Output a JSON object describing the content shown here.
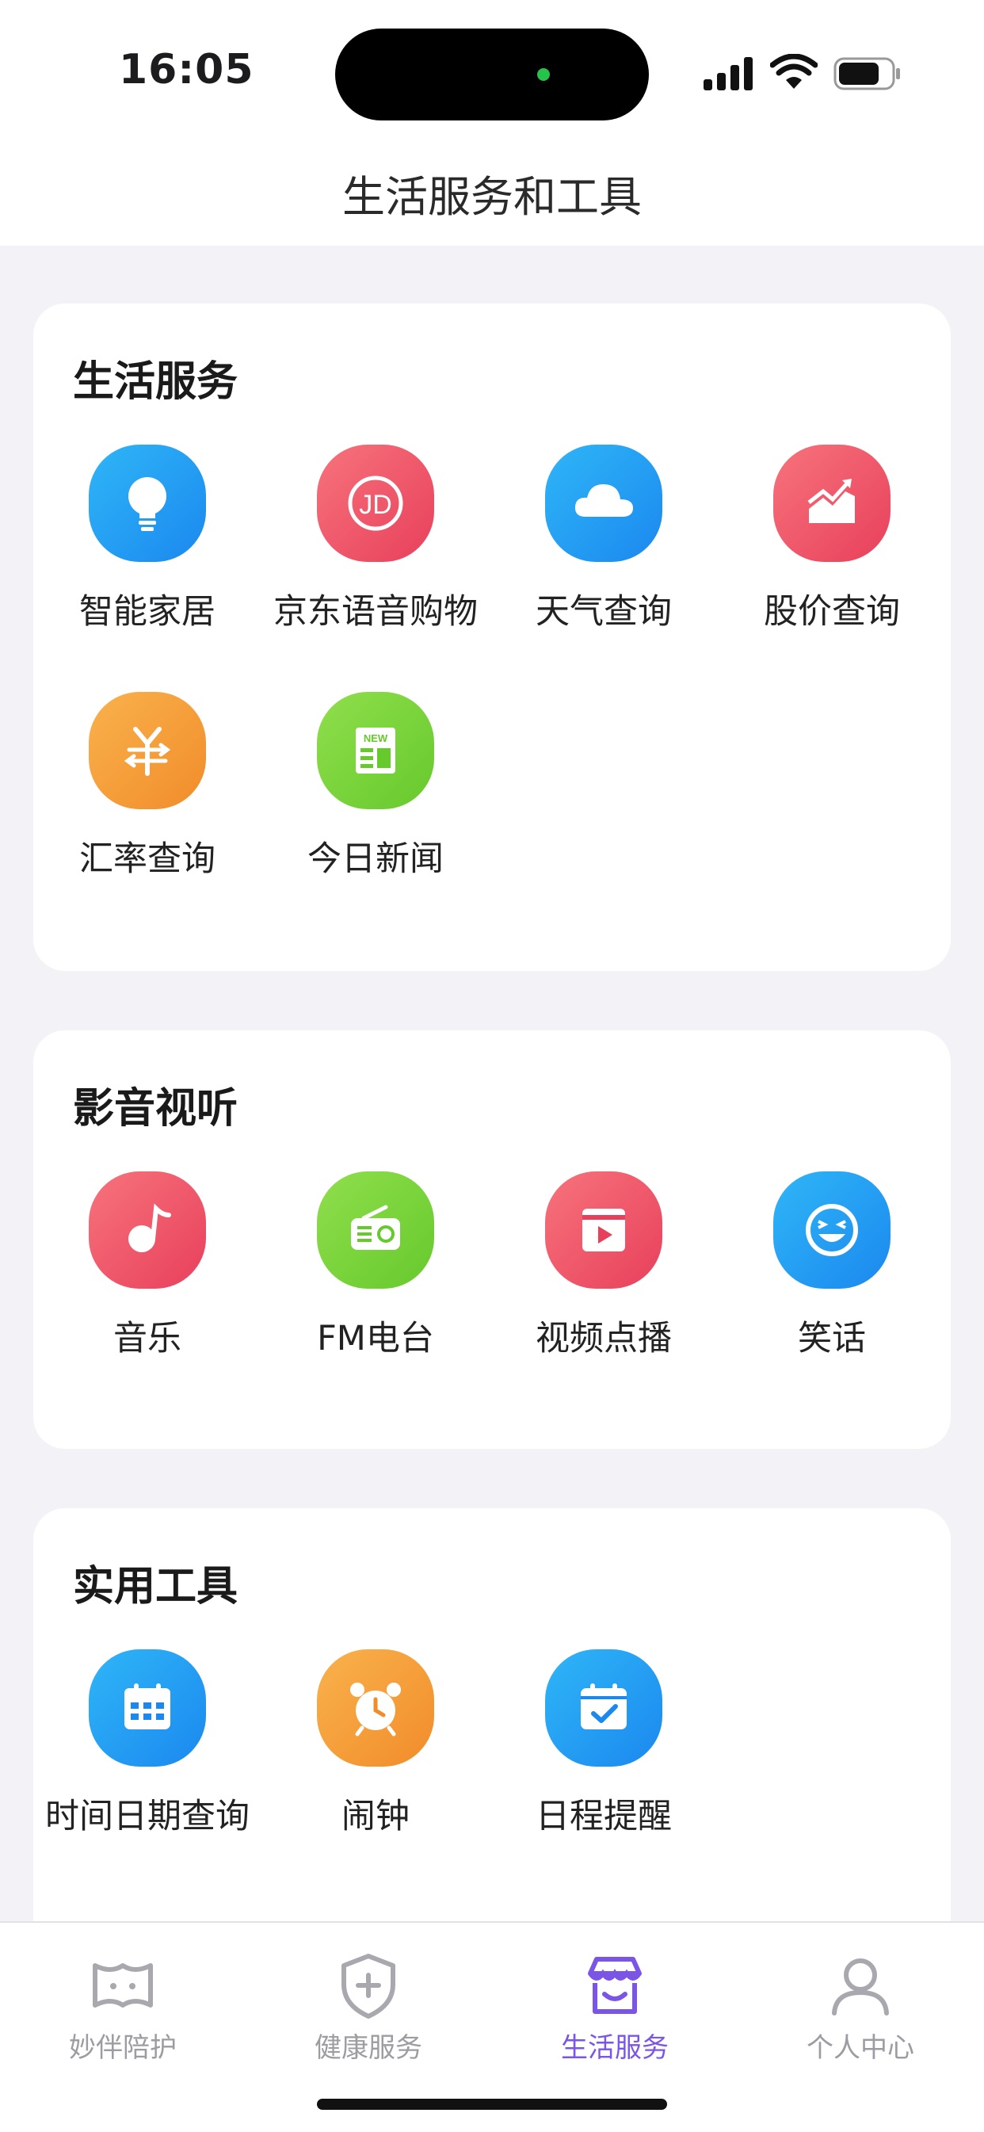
{
  "status_bar": {
    "time": "16:05"
  },
  "header": {
    "title": "生活服务和工具"
  },
  "sections": [
    {
      "title": "生活服务",
      "items": [
        {
          "label": "智能家居",
          "icon": "lightbulb-icon",
          "color": "blue"
        },
        {
          "label": "京东语音购物",
          "icon": "jd-logo-icon",
          "color": "red"
        },
        {
          "label": "天气查询",
          "icon": "cloud-icon",
          "color": "blue"
        },
        {
          "label": "股价查询",
          "icon": "stock-chart-icon",
          "color": "red"
        },
        {
          "label": "汇率查询",
          "icon": "currency-exchange-icon",
          "color": "orange"
        },
        {
          "label": "今日新闻",
          "icon": "news-icon",
          "color": "green"
        }
      ]
    },
    {
      "title": "影音视听",
      "items": [
        {
          "label": "音乐",
          "icon": "music-note-icon",
          "color": "red"
        },
        {
          "label": "FM电台",
          "icon": "radio-icon",
          "color": "green"
        },
        {
          "label": "视频点播",
          "icon": "video-play-icon",
          "color": "red"
        },
        {
          "label": "笑话",
          "icon": "laughing-face-icon",
          "color": "blue"
        }
      ]
    },
    {
      "title": "实用工具",
      "items": [
        {
          "label": "时间日期查询",
          "icon": "calendar-icon",
          "color": "blue"
        },
        {
          "label": "闹钟",
          "icon": "alarm-clock-icon",
          "color": "orange"
        },
        {
          "label": "日程提醒",
          "icon": "schedule-check-icon",
          "color": "blue"
        }
      ]
    }
  ],
  "tabbar": {
    "tabs": [
      {
        "label": "妙伴陪护",
        "icon": "companion-icon",
        "active": false
      },
      {
        "label": "健康服务",
        "icon": "health-shield-icon",
        "active": false
      },
      {
        "label": "生活服务",
        "icon": "store-icon",
        "active": true
      },
      {
        "label": "个人中心",
        "icon": "profile-icon",
        "active": false
      }
    ]
  },
  "colors": {
    "accent": "#7b55e6",
    "blue": "#1b88ef",
    "red": "#e8405b",
    "orange": "#f18c2a",
    "green": "#66c92c"
  }
}
